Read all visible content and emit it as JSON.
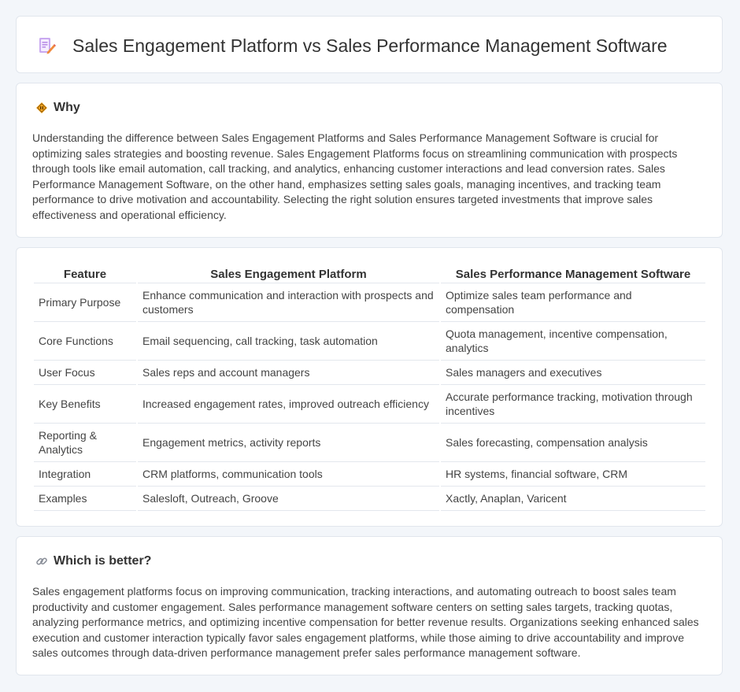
{
  "header": {
    "title": "Sales Engagement Platform vs Sales Performance Management Software",
    "icon": "document-pen-icon"
  },
  "why": {
    "heading": "Why",
    "icon": "diamond-sign-icon",
    "text": "Understanding the difference between Sales Engagement Platforms and Sales Performance Management Software is crucial for optimizing sales strategies and boosting revenue. Sales Engagement Platforms focus on streamlining communication with prospects through tools like email automation, call tracking, and analytics, enhancing customer interactions and lead conversion rates. Sales Performance Management Software, on the other hand, emphasizes setting sales goals, managing incentives, and tracking team performance to drive motivation and accountability. Selecting the right solution ensures targeted investments that improve sales effectiveness and operational efficiency."
  },
  "comparison": {
    "headers": [
      "Feature",
      "Sales Engagement Platform",
      "Sales Performance Management Software"
    ],
    "rows": [
      [
        "Primary Purpose",
        "Enhance communication and interaction with prospects and customers",
        "Optimize sales team performance and compensation"
      ],
      [
        "Core Functions",
        "Email sequencing, call tracking, task automation",
        "Quota management, incentive compensation, analytics"
      ],
      [
        "User Focus",
        "Sales reps and account managers",
        "Sales managers and executives"
      ],
      [
        "Key Benefits",
        "Increased engagement rates, improved outreach efficiency",
        "Accurate performance tracking, motivation through incentives"
      ],
      [
        "Reporting & Analytics",
        "Engagement metrics, activity reports",
        "Sales forecasting, compensation analysis"
      ],
      [
        "Integration",
        "CRM platforms, communication tools",
        "HR systems, financial software, CRM"
      ],
      [
        "Examples",
        "Salesloft, Outreach, Groove",
        "Xactly, Anaplan, Varicent"
      ]
    ]
  },
  "better": {
    "heading": "Which is better?",
    "icon": "link-icon",
    "text": "Sales engagement platforms focus on improving communication, tracking interactions, and automating outreach to boost sales team productivity and customer engagement. Sales performance management software centers on setting sales targets, tracking quotas, analyzing performance metrics, and optimizing incentive compensation for better revenue results. Organizations seeking enhanced sales execution and customer interaction typically favor sales engagement platforms, while those aiming to drive accountability and improve sales outcomes through data-driven performance management prefer sales performance management software."
  }
}
